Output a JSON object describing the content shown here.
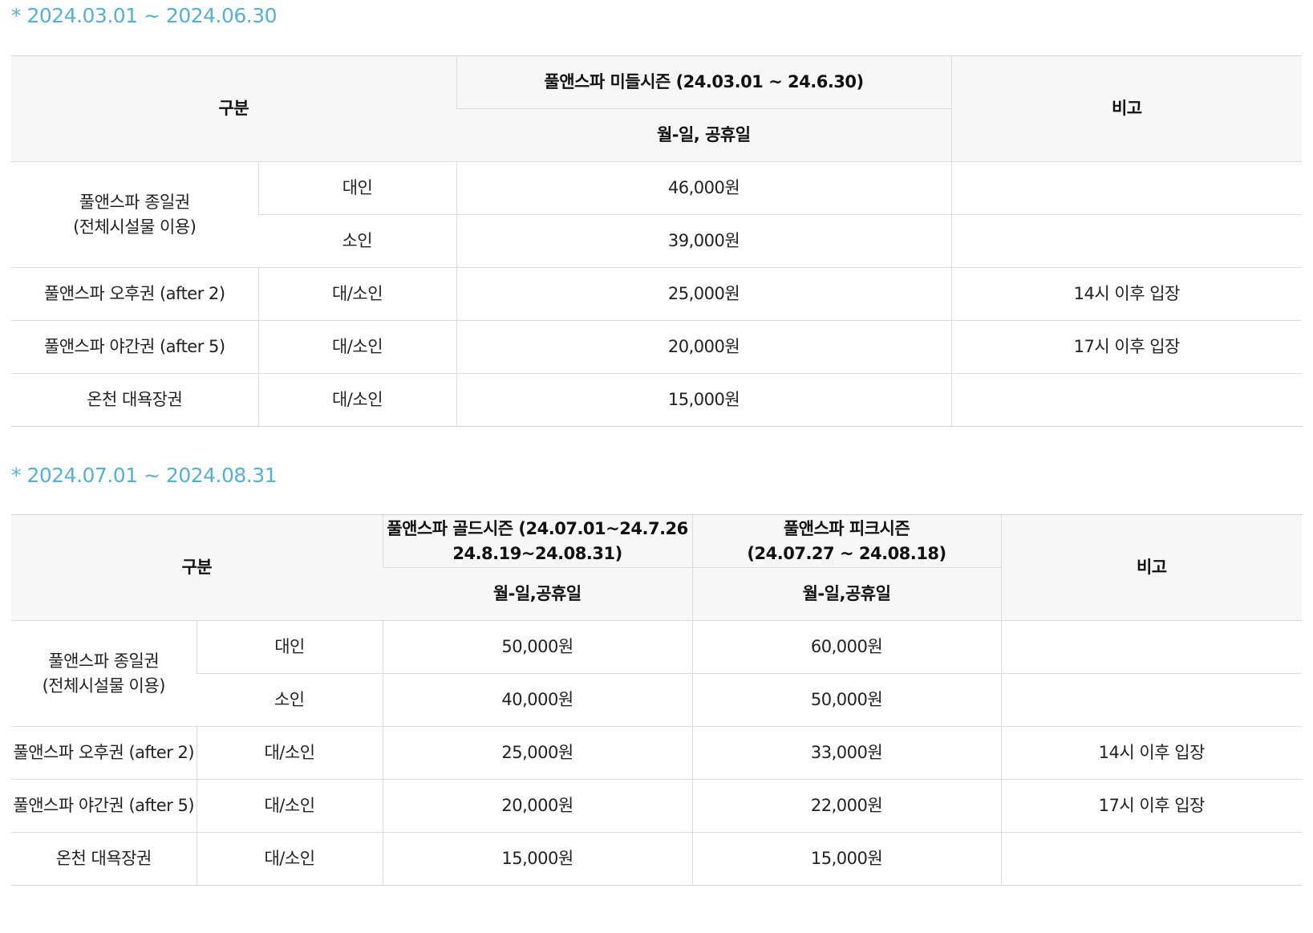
{
  "section_1": {
    "period_label": "* 2024.03.01 ~ 2024.06.30",
    "headers": {
      "category": "구분",
      "season": "풀앤스파 미들시즌 (24.03.01 ~ 24.6.30)",
      "days": "월-일, 공휴일",
      "note": "비고"
    },
    "rows": {
      "fullday": {
        "name_line1": "풀앤스파 종일권",
        "name_line2": "(전체시설물 이용)",
        "adult_label": "대인",
        "adult_price": "46,000원",
        "child_label": "소인",
        "child_price": "39,000원"
      },
      "afternoon": {
        "name": "풀앤스파 오후권 (after 2)",
        "target": "대/소인",
        "price": "25,000원",
        "note": "14시 이후 입장"
      },
      "night": {
        "name": "풀앤스파 야간권 (after 5)",
        "target": "대/소인",
        "price": "20,000원",
        "note": "17시 이후 입장"
      },
      "bath": {
        "name": "온천 대욕장권",
        "target": "대/소인",
        "price": "15,000원"
      }
    }
  },
  "section_2": {
    "period_label": "* 2024.07.01 ~ 2024.08.31",
    "headers": {
      "category": "구분",
      "gold_line1": "풀앤스파 골드시즌 (24.07.01~24.7.26",
      "gold_line2": "24.8.19~24.08.31)",
      "peak_line1": "풀앤스파 피크시즌",
      "peak_line2": "(24.07.27 ~ 24.08.18)",
      "gold_days": "월-일,공휴일",
      "peak_days": "월-일,공휴일",
      "note": "비고"
    },
    "rows": {
      "fullday": {
        "name_line1": "풀앤스파 종일권",
        "name_line2": "(전체시설물 이용)",
        "adult_label": "대인",
        "adult_gold": "50,000원",
        "adult_peak": "60,000원",
        "child_label": "소인",
        "child_gold": "40,000원",
        "child_peak": "50,000원"
      },
      "afternoon": {
        "name": "풀앤스파 오후권 (after 2)",
        "target": "대/소인",
        "gold": "25,000원",
        "peak": "33,000원",
        "note": "14시 이후 입장"
      },
      "night": {
        "name": "풀앤스파 야간권 (after 5)",
        "target": "대/소인",
        "gold": "20,000원",
        "peak": "22,000원",
        "note": "17시 이후 입장"
      },
      "bath": {
        "name": "온천 대욕장권",
        "target": "대/소인",
        "gold": "15,000원",
        "peak": "15,000원"
      }
    }
  }
}
